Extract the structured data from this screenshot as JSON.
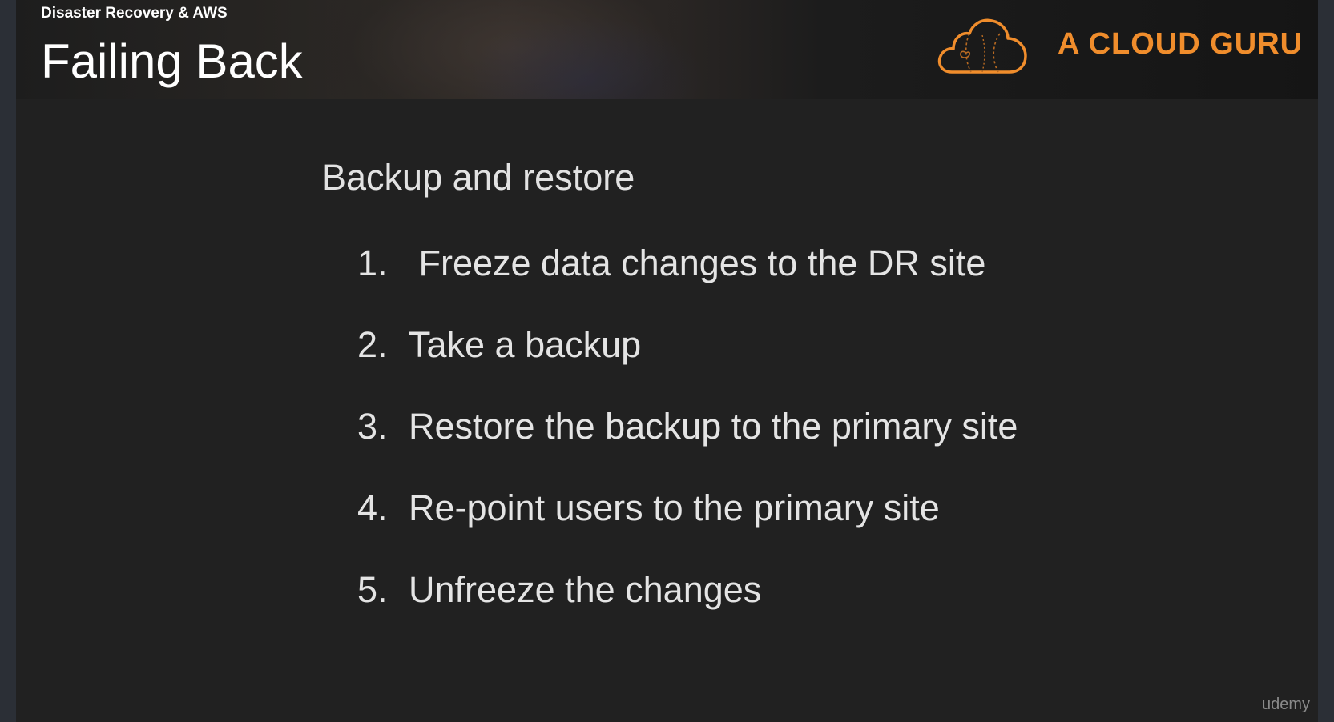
{
  "header": {
    "course_title": "Disaster Recovery & AWS",
    "slide_title": "Failing Back",
    "logo": {
      "icon": "cloud-icon",
      "text": "A CLOUD GURU",
      "color": "#f08d2c"
    }
  },
  "content": {
    "heading": "Backup and restore",
    "steps": [
      {
        "number": "1.",
        "text": " Freeze data changes to the DR site"
      },
      {
        "number": "2.",
        "text": "Take a backup"
      },
      {
        "number": "3.",
        "text": "Restore the backup to the primary site"
      },
      {
        "number": "4.",
        "text": "Re-point users to the primary site"
      },
      {
        "number": "5.",
        "text": "Unfreeze the changes"
      }
    ]
  },
  "watermark": "udemy"
}
